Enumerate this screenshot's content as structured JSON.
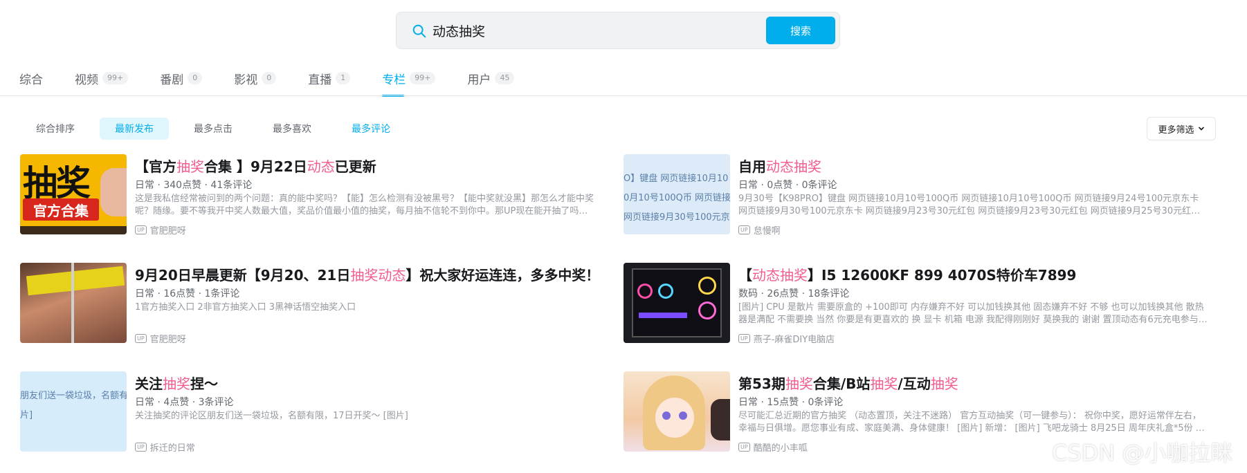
{
  "search": {
    "query": "动态抽奖",
    "button_label": "搜索"
  },
  "tabs": [
    {
      "label": "综合",
      "badge": ""
    },
    {
      "label": "视频",
      "badge": "99+"
    },
    {
      "label": "番剧",
      "badge": "0"
    },
    {
      "label": "影视",
      "badge": "0"
    },
    {
      "label": "直播",
      "badge": "1"
    },
    {
      "label": "专栏",
      "badge": "99+",
      "active": true
    },
    {
      "label": "用户",
      "badge": "45"
    }
  ],
  "sort_options": [
    "综合排序",
    "最新发布",
    "最多点击",
    "最多喜欢",
    "最多评论"
  ],
  "filter_label": "更多筛选",
  "cards": [
    {
      "title_parts": [
        "【官方",
        "抽奖",
        "合集 】9月22日",
        "动态",
        "已更新"
      ],
      "meta": "日常 · 340点赞 · 41条评论",
      "desc": "这是我私信经常被问到的两个问题：真的能中奖吗？【能】怎么检测有没被黑号？【能中奖就没黑】那怎么才能中奖呢？随缘。要不等我开中奖人数最大值，奖品价值最小值的抽奖，每月抽不信轮不到你中。那UP现在能开抽了吗…",
      "author": "官肥肥呀",
      "thumb_text": [
        "抽奖",
        "官方合集"
      ]
    },
    {
      "title_parts": [
        "自用",
        "动态抽奖",
        ""
      ],
      "meta": "日常 · 0点赞 · 0条评论",
      "desc": "9月30号【K98PRO】键盘 网页链接10月10号100Q币 网页链接10月10号100Q币 网页链接9月24号100元京东卡 网页链接9月30号100元京东卡 网页链接9月23号30元红包 网页链接9月23号30元红包 网页链接9月25号30元红包 网页链…",
      "author": "怠慢啊",
      "thumb_text": [
        "O】键盘 网页链接10月10",
        "0月10号100Q币 网页链接",
        "网页链接9月30号100元京"
      ]
    },
    {
      "title_parts": [
        "9月20日早晨更新【9月20、21日",
        "抽奖动态",
        "】祝大家好运连连，多多中奖！"
      ],
      "meta": "日常 · 16点赞 · 1条评论",
      "desc": "1官方抽奖入口 2非官方抽奖入口 3黑神话悟空抽奖入口",
      "author": "官肥肥呀",
      "thumb_text": []
    },
    {
      "title_parts": [
        "【",
        "动态抽奖",
        "】I5 12600KF 899 4070S特价车7899"
      ],
      "meta": "数码 · 26点赞 · 18条评论",
      "desc": "[图片] CPU 是散片 需要原盒的 +100即可 内存嫌弃不好 可以加钱换其他 固态嫌弃不好 不够 也可以加钱换其他 散热器是满配 不需要换 当然 你要是有更喜欢的 换 显卡 机箱 电源 我配得刚刚好 莫换我的 谢谢 置顶动态有6元充电参与…",
      "author": "燕子-麻雀DIY电脑店",
      "thumb_text": []
    },
    {
      "title_parts": [
        "关注",
        "抽奖",
        "捏～"
      ],
      "meta": "日常 · 4点赞 · 3条评论",
      "desc": "关注抽奖的评论区朋友们送一袋垃圾，名额有限，17日开奖～ [图片]",
      "author": "拆迁的日常",
      "thumb_text": [
        "朋友们送一袋垃圾，名额有",
        "片]"
      ]
    },
    {
      "title_parts": [
        "第53期",
        "抽奖",
        "合集/B站",
        "抽奖",
        "/互动",
        "抽奖",
        ""
      ],
      "meta": "日常 · 15点赞 · 0条评论",
      "desc": "尽可能汇总近期的官方抽奖 （动态置顶，关注不迷路） 官方互动抽奖（可一键参与）： 祝你中奖，愿好运常伴左右，幸福与日俱增。愿您事业有成、家庭美满、身体健康！ [图片] 新增： [图片] 飞吧龙骑士 8月25日 周年庆礼盒*5份 …",
      "author": "酷酷的小丰呱",
      "thumb_text": []
    }
  ],
  "up_tag": "UP",
  "watermark": "CSDN @小咖拉眯",
  "colors": {
    "accent": "#00aeec",
    "highlight": "#f25d8e"
  }
}
